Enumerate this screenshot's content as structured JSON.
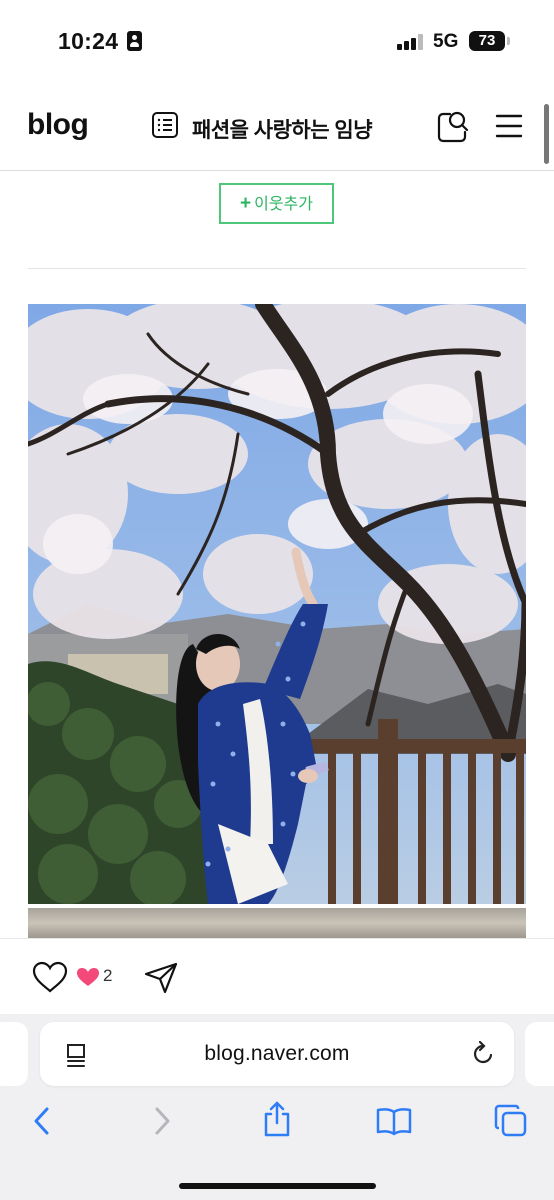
{
  "status_bar": {
    "time": "10:24",
    "network": "5G",
    "battery": "73"
  },
  "header": {
    "logo": "blog",
    "blog_title": "패션을 사랑하는 임냥"
  },
  "follow": {
    "plus": "+",
    "label": "이웃추가"
  },
  "post_actions": {
    "like_count": "2"
  },
  "browser": {
    "url": "blog.naver.com"
  },
  "colors": {
    "accent_green": "#2db462",
    "ios_blue": "#2f7df6",
    "like_pink": "#f2487a"
  }
}
